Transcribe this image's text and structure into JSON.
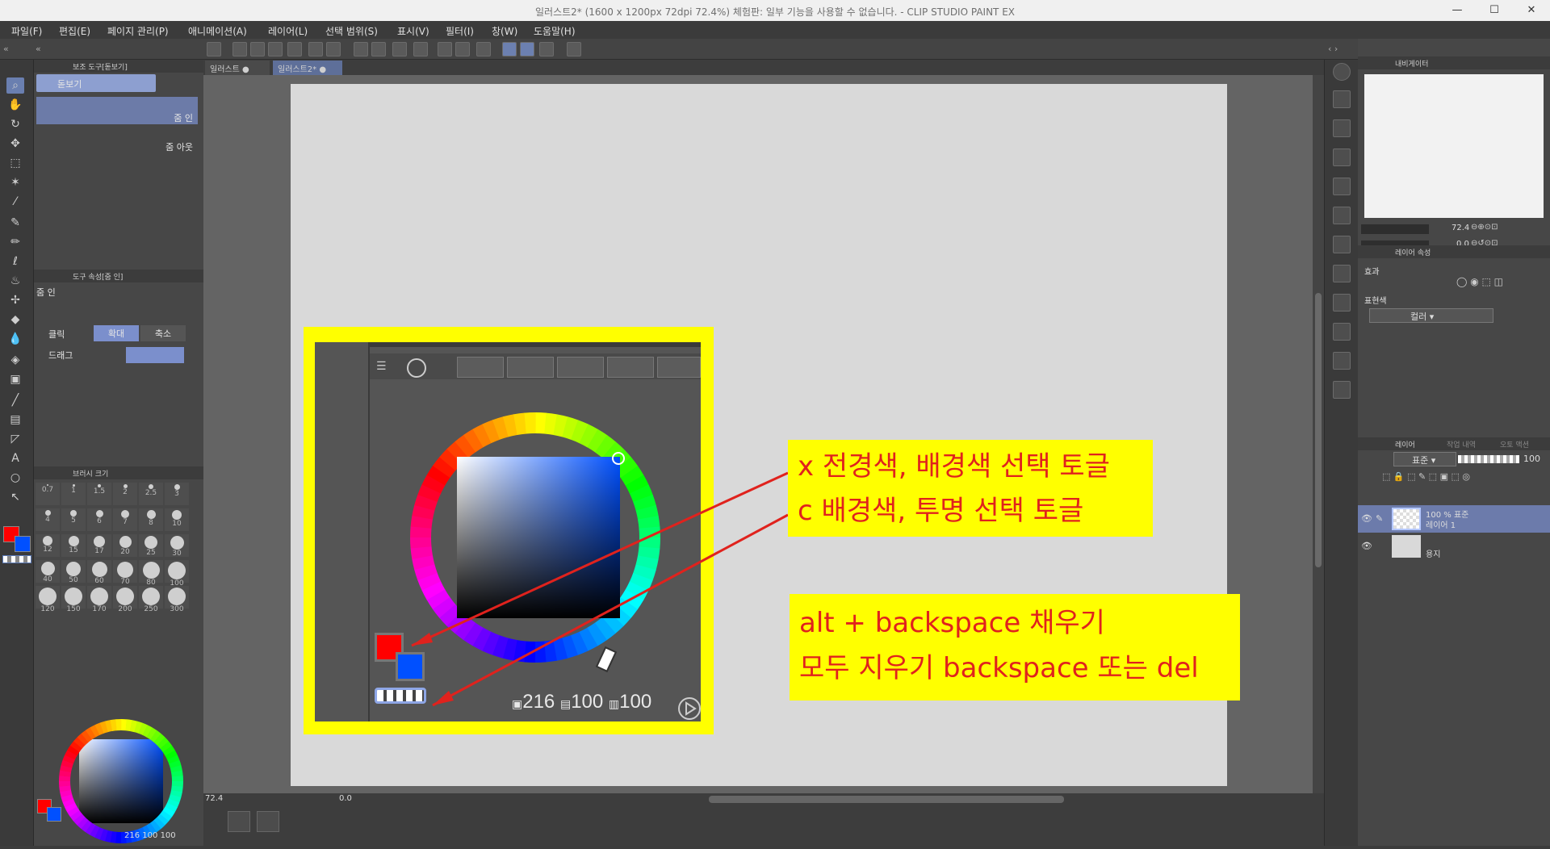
{
  "window": {
    "title": "일러스트2* (1600 x 1200px 72dpi 72.4%)  체험판: 일부 기능을 사용할 수 없습니다. - CLIP STUDIO PAINT EX",
    "minimize": "—",
    "maximize": "☐",
    "close": "✕"
  },
  "menu": [
    "파일(F)",
    "편집(E)",
    "페이지 관리(P)",
    "애니메이션(A)",
    "레이어(L)",
    "선택 범위(S)",
    "표시(V)",
    "필터(I)",
    "창(W)",
    "도움말(H)"
  ],
  "sub_tool": {
    "header": "보조 도구[돋보기]",
    "tool_name": "돋보기",
    "items": [
      "줌 인",
      "줌 아웃"
    ]
  },
  "tool_property": {
    "header": "도구 속성[줌 인]",
    "name": "줌 인",
    "click_label": "클릭",
    "zoom_in": "확대",
    "zoom_out": "축소",
    "drag_label": "드래그"
  },
  "brush_size": {
    "header": "브러시 크기",
    "sizes": [
      "0.7",
      "1",
      "1.5",
      "2",
      "2.5",
      "3",
      "4",
      "5",
      "6",
      "7",
      "8",
      "10",
      "12",
      "15",
      "17",
      "20",
      "25",
      "30",
      "40",
      "50",
      "60",
      "70",
      "80",
      "100",
      "120",
      "150",
      "170",
      "200",
      "250",
      "300"
    ]
  },
  "color_panel": {
    "hsv": [
      "216",
      "100",
      "100"
    ],
    "fg_color": "#ff0000",
    "bg_color": "#0050ff"
  },
  "canvas_tabs": [
    "일러스트",
    "일러스트2*"
  ],
  "annotations": {
    "box1": [
      "x 전경색, 배경색 선택 토글",
      "c 배경색, 투명 선택 토글"
    ],
    "box2": [
      "alt + backspace 채우기",
      "모두 지우기 backspace 또는 del"
    ]
  },
  "zoomed_color": {
    "h": "216",
    "s": "100",
    "v": "100"
  },
  "status": {
    "zoom": "72.4",
    "rotation": "0.0"
  },
  "navigator": {
    "header": "내비게이터",
    "zoom": "72.4",
    "angle": "0.0"
  },
  "layer_property": {
    "header": "레이어 속성",
    "effect_label": "효과",
    "expression_label": "표현색",
    "expression_value": "컬러"
  },
  "layers": {
    "header": "레이어",
    "tab2": "작업 내역",
    "tab3": "오토 액션",
    "blend": "표준",
    "opacity": "100",
    "items": [
      {
        "info": "100 % 표준",
        "name": "레이어 1"
      },
      {
        "info": "",
        "name": "용지"
      }
    ]
  }
}
